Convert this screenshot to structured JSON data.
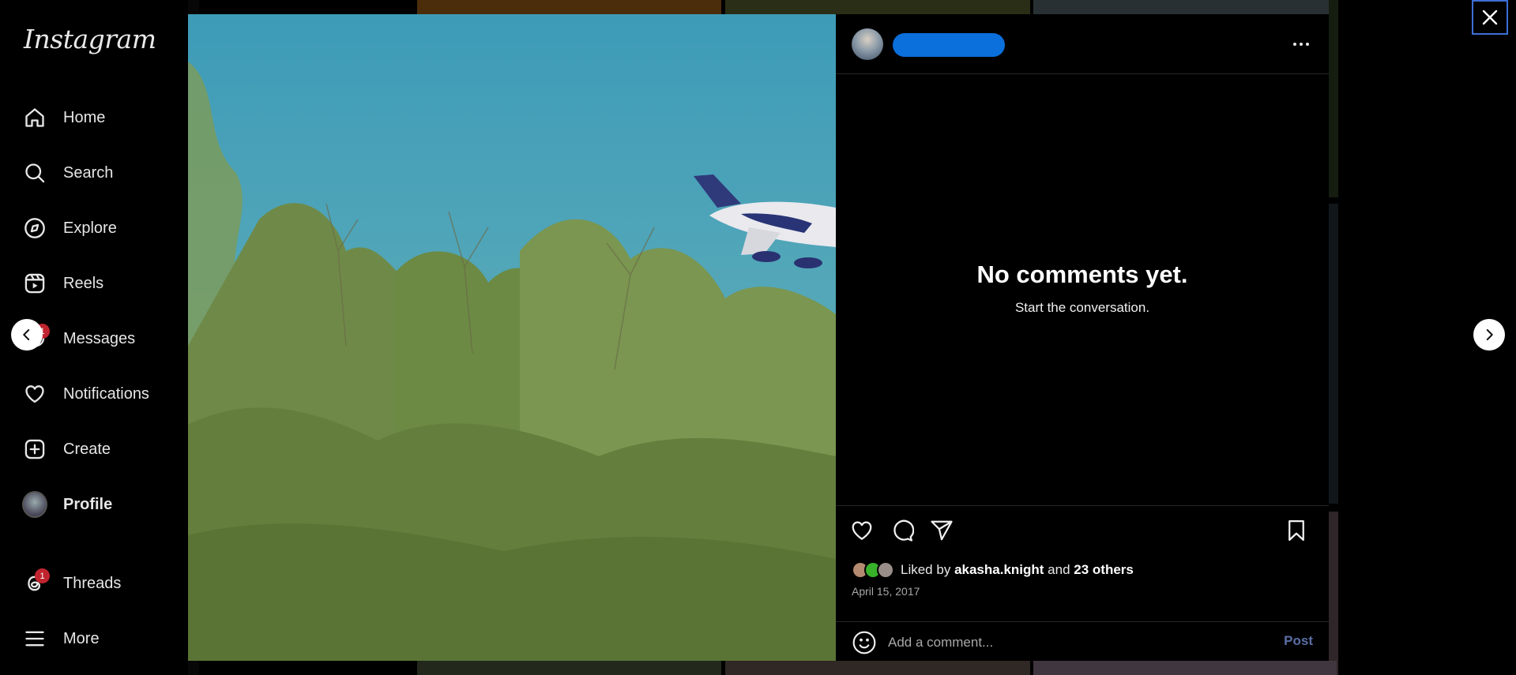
{
  "app": {
    "logo": "Instagram"
  },
  "sidebar": {
    "items": [
      {
        "label": "Home",
        "icon": "home-icon"
      },
      {
        "label": "Search",
        "icon": "search-icon"
      },
      {
        "label": "Explore",
        "icon": "compass-icon"
      },
      {
        "label": "Reels",
        "icon": "reels-icon"
      },
      {
        "label": "Messages",
        "icon": "messenger-icon",
        "badge": "1"
      },
      {
        "label": "Notifications",
        "icon": "heart-icon"
      },
      {
        "label": "Create",
        "icon": "plus-square-icon"
      },
      {
        "label": "Profile",
        "icon": "avatar"
      },
      {
        "label": "Threads",
        "icon": "threads-icon",
        "badge": "1"
      },
      {
        "label": "More",
        "icon": "hamburger-icon"
      }
    ]
  },
  "post": {
    "empty_title": "No comments yet.",
    "empty_subtitle": "Start the conversation.",
    "liked_prefix": "Liked by",
    "liked_user": "akasha.knight",
    "liked_and": "and",
    "liked_others": "23 others",
    "date": "April 15, 2017",
    "comment_placeholder": "Add a comment...",
    "post_label": "Post"
  },
  "colors": {
    "accent_blue": "#0b6fdc",
    "badge_red": "#c0242f",
    "post_button": "#5b6fa6"
  }
}
